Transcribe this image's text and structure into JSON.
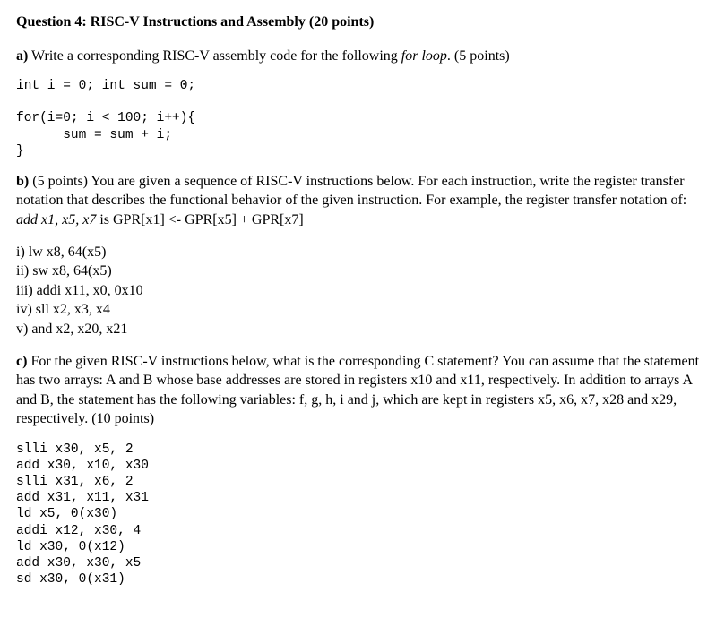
{
  "title": "Question 4: RISC-V Instructions and Assembly (20 points)",
  "partA": {
    "label": "a)",
    "text1": " Write a corresponding RISC-V assembly code for the following ",
    "italic": "for loop",
    "text2": ". (5 points)",
    "code": "int i = 0; int sum = 0;\n\nfor(i=0; i < 100; i++){\n      sum = sum + i;\n}"
  },
  "partB": {
    "label": "b)",
    "text1": " (5 points) You are given a sequence of RISC-V instructions below. For each instruction, write the register transfer notation that describes the functional behavior of the given instruction. For example, the register transfer notation of: ",
    "italic": "add x1, x5, x7",
    "text2": "  is GPR[x1] <- GPR[x5] + GPR[x7]",
    "items": [
      "i) lw x8, 64(x5)",
      "ii) sw x8, 64(x5)",
      "iii) addi x11, x0, 0x10",
      "iv) sll x2, x3, x4",
      "v) and x2, x20, x21"
    ]
  },
  "partC": {
    "label": "c)",
    "text": " For the given RISC-V instructions below, what is the corresponding C statement? You can assume that the statement has two arrays: A and B whose base addresses are stored in registers x10 and x11, respectively. In addition to arrays A and B, the statement has the following variables: f, g, h, i and j, which are kept in registers x5, x6, x7, x28 and x29, respectively.  (10 points)",
    "code": "slli x30, x5, 2\nadd x30, x10, x30\nslli x31, x6, 2\nadd x31, x11, x31\nld x5, 0(x30)\naddi x12, x30, 4\nld x30, 0(x12)\nadd x30, x30, x5\nsd x30, 0(x31)"
  }
}
